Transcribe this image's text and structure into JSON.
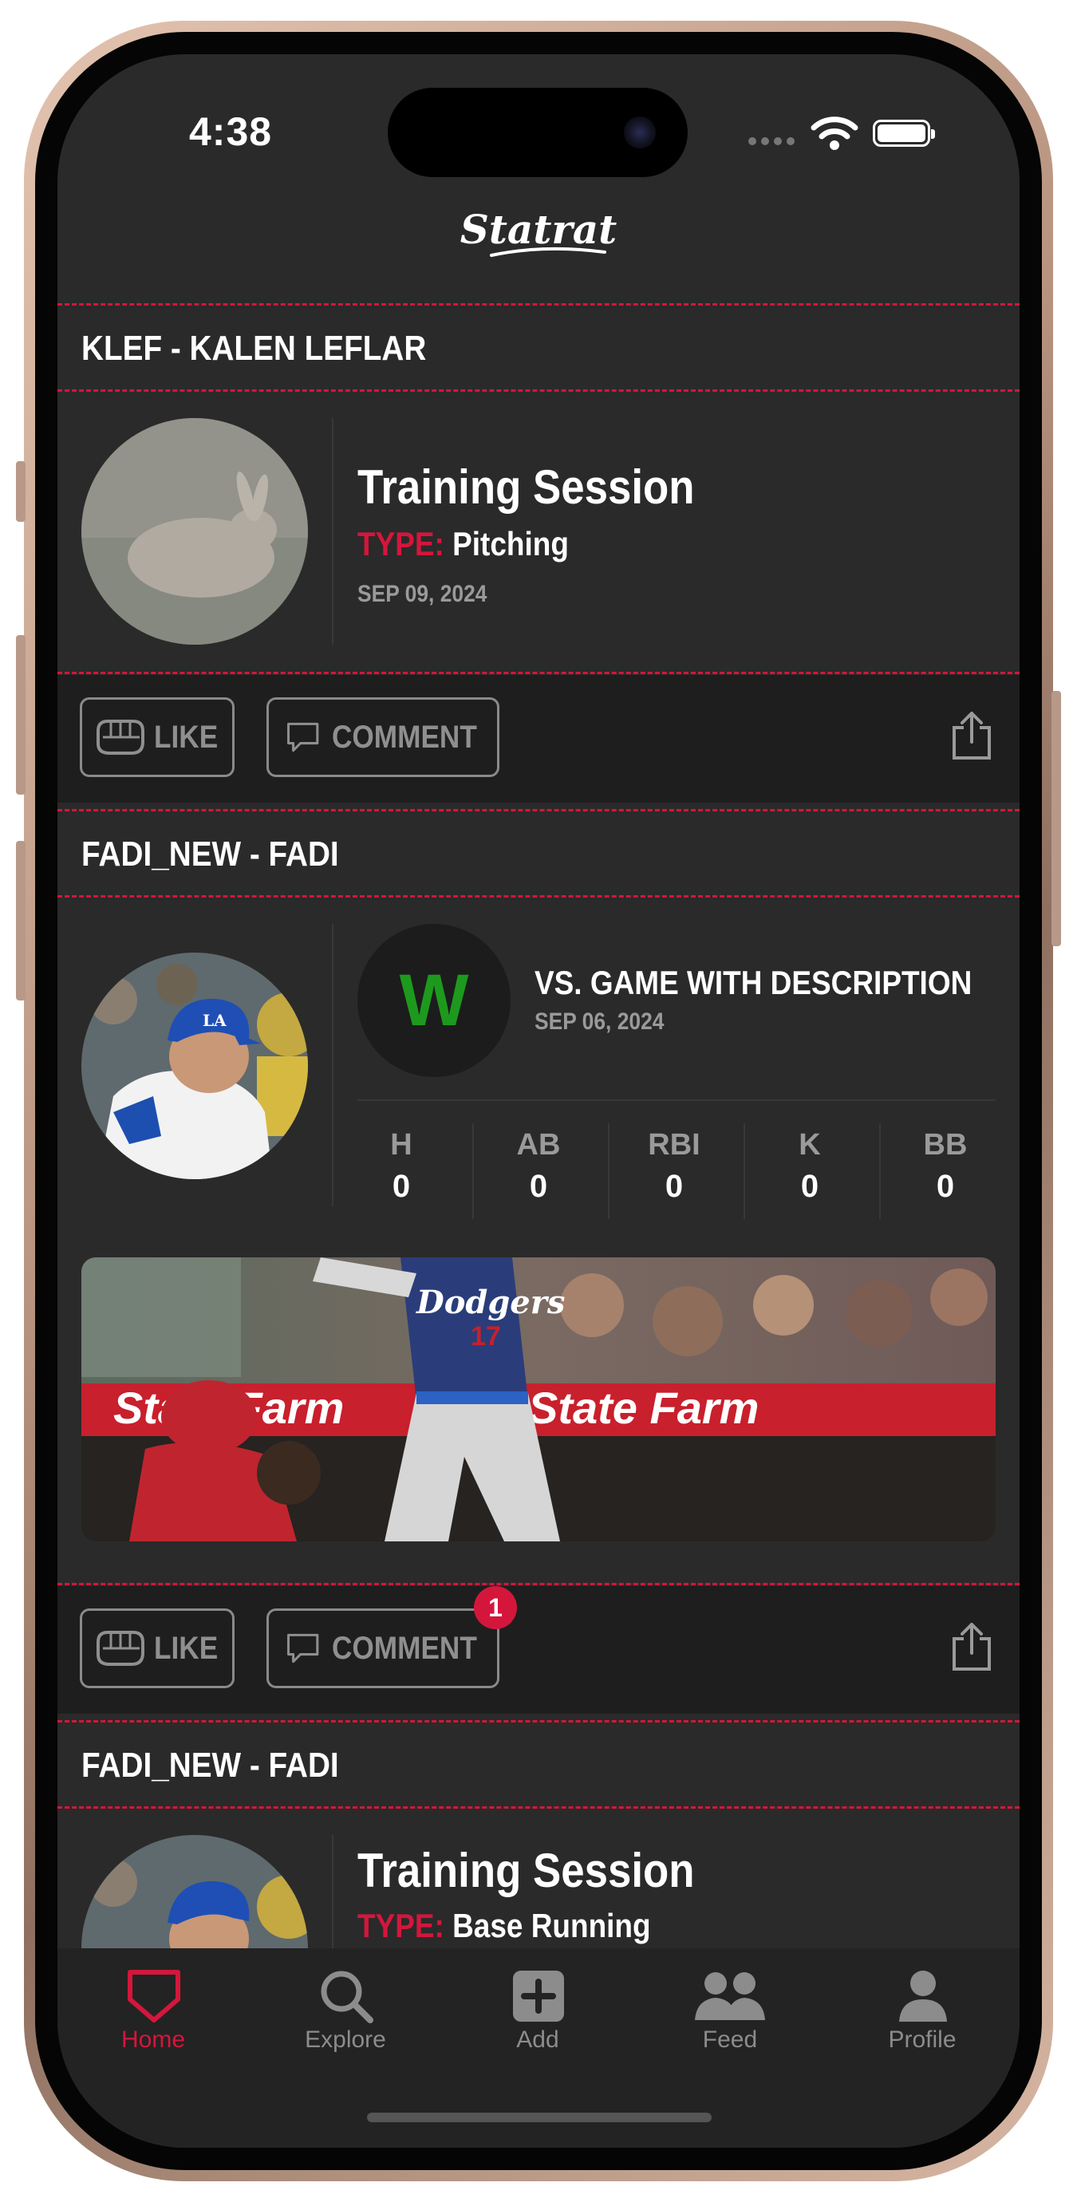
{
  "status_bar": {
    "time": "4:38"
  },
  "app": {
    "logo_text": "Statrat"
  },
  "colors": {
    "accent": "#d4163c",
    "background": "#2a2a2a",
    "win": "#1d9a1d"
  },
  "feed": [
    {
      "user": "KLEF - KALEN LEFLAR",
      "title": "Training Session",
      "type_label": "TYPE:",
      "type_value": "Pitching",
      "date": "SEP 09, 2024",
      "like_label": "LIKE",
      "comment_label": "COMMENT"
    },
    {
      "user": "FADI_NEW - FADI",
      "result": "W",
      "title": "VS. GAME WITH DESCRIPTION",
      "date": "SEP 06, 2024",
      "stats": [
        {
          "label": "H",
          "value": "0"
        },
        {
          "label": "AB",
          "value": "0"
        },
        {
          "label": "RBI",
          "value": "0"
        },
        {
          "label": "K",
          "value": "0"
        },
        {
          "label": "BB",
          "value": "0"
        }
      ],
      "photo_ad_text": "State Farm",
      "photo_jersey_text": "Dodgers",
      "photo_jersey_number": "17",
      "like_label": "LIKE",
      "comment_label": "COMMENT",
      "comment_badge": "1"
    },
    {
      "user": "FADI_NEW - FADI",
      "title": "Training Session",
      "type_label": "TYPE:",
      "type_value": "Base Running"
    }
  ],
  "tabbar": [
    {
      "label": "Home",
      "icon": "home-plate-icon",
      "active": true
    },
    {
      "label": "Explore",
      "icon": "search-icon",
      "active": false
    },
    {
      "label": "Add",
      "icon": "plus-square-icon",
      "active": false
    },
    {
      "label": "Feed",
      "icon": "people-icon",
      "active": false
    },
    {
      "label": "Profile",
      "icon": "person-icon",
      "active": false
    }
  ]
}
